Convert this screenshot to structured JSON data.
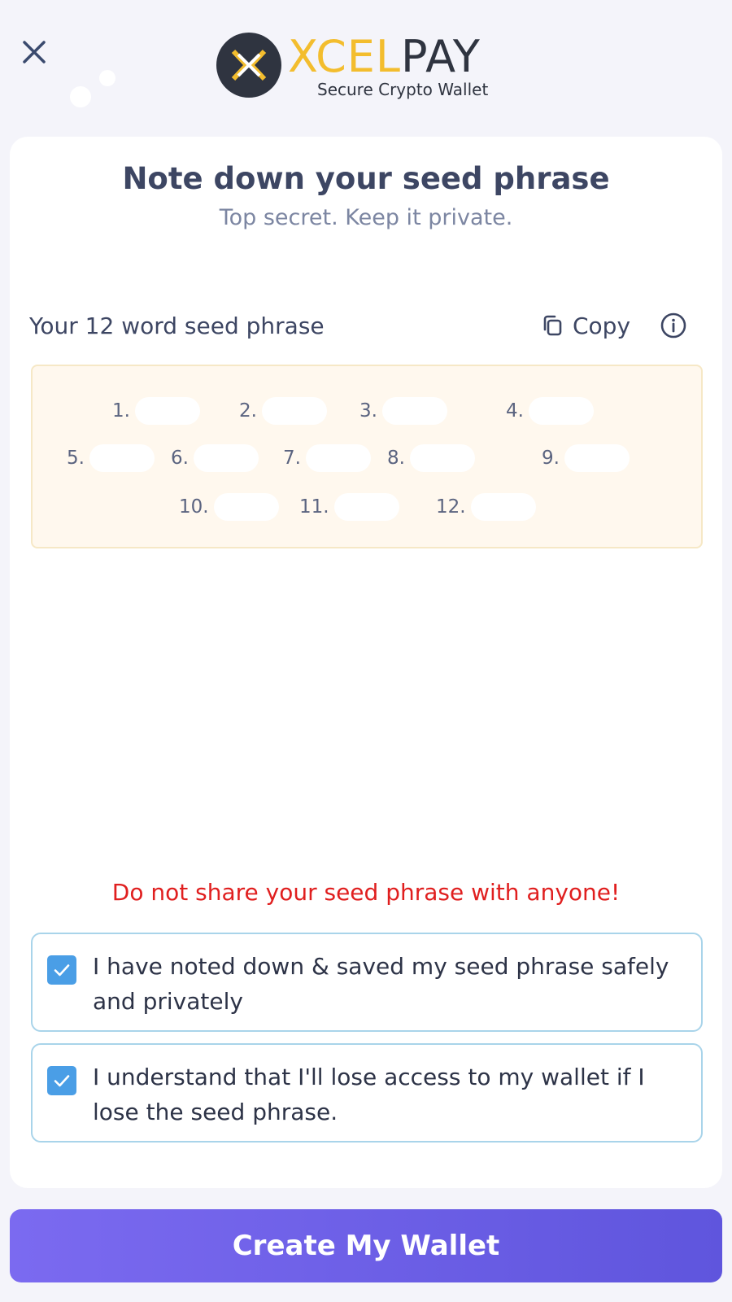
{
  "header": {
    "brand_part1": "XCEL",
    "brand_part2": "PAY",
    "tagline": "Secure Crypto Wallet"
  },
  "main": {
    "title": "Note down your seed phrase",
    "subtitle": "Top secret. Keep it private.",
    "seed_label": "Your 12 word seed phrase",
    "copy_label": "Copy",
    "seed_words": [
      "1.",
      "2.",
      "3.",
      "4.",
      "5.",
      "6.",
      "7.",
      "8.",
      "9.",
      "10.",
      "11.",
      "12."
    ],
    "warning": "Do not share your seed phrase with anyone!",
    "checks": [
      {
        "text": "I have noted down & saved my seed phrase safely and privately",
        "checked": true
      },
      {
        "text": "I understand that I'll lose access to my wallet if I lose the seed phrase.",
        "checked": true
      }
    ]
  },
  "footer": {
    "cta_label": "Create My Wallet"
  },
  "colors": {
    "accent_gold": "#f3bd2e",
    "warning_red": "#e01f1f",
    "checkbox_blue": "#4a9ee6",
    "cta_start": "#7b6af0",
    "cta_end": "#5f55dd"
  }
}
